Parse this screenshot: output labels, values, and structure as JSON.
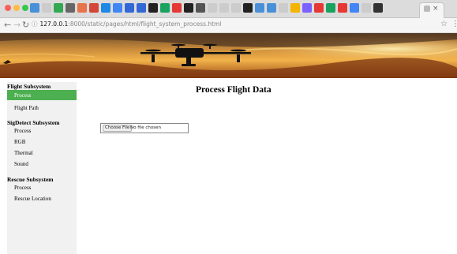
{
  "browser": {
    "url_host": "127.0.0.1",
    "url_path": ":8000/static/pages/html/flight_system_process.html",
    "back_icon": "arrow-left",
    "forward_icon": "arrow-right",
    "reload_icon": "reload",
    "bookmark_icon": "star",
    "tab_close": "×"
  },
  "sidebar": {
    "sections": [
      {
        "heading": "Flight Subsystem",
        "items": [
          "Process",
          "Flight Path"
        ]
      },
      {
        "heading": "SigDetect Subsystem",
        "items": [
          "Process",
          "RGB",
          "Thermal",
          "Sound"
        ]
      },
      {
        "heading": "Rescue Subsystem",
        "items": [
          "Process",
          "Rescue Location"
        ]
      }
    ],
    "active_color": "#4caf50"
  },
  "main": {
    "title": "Process Flight Data",
    "file_button": "Choose File",
    "file_status": "No file chosen"
  }
}
